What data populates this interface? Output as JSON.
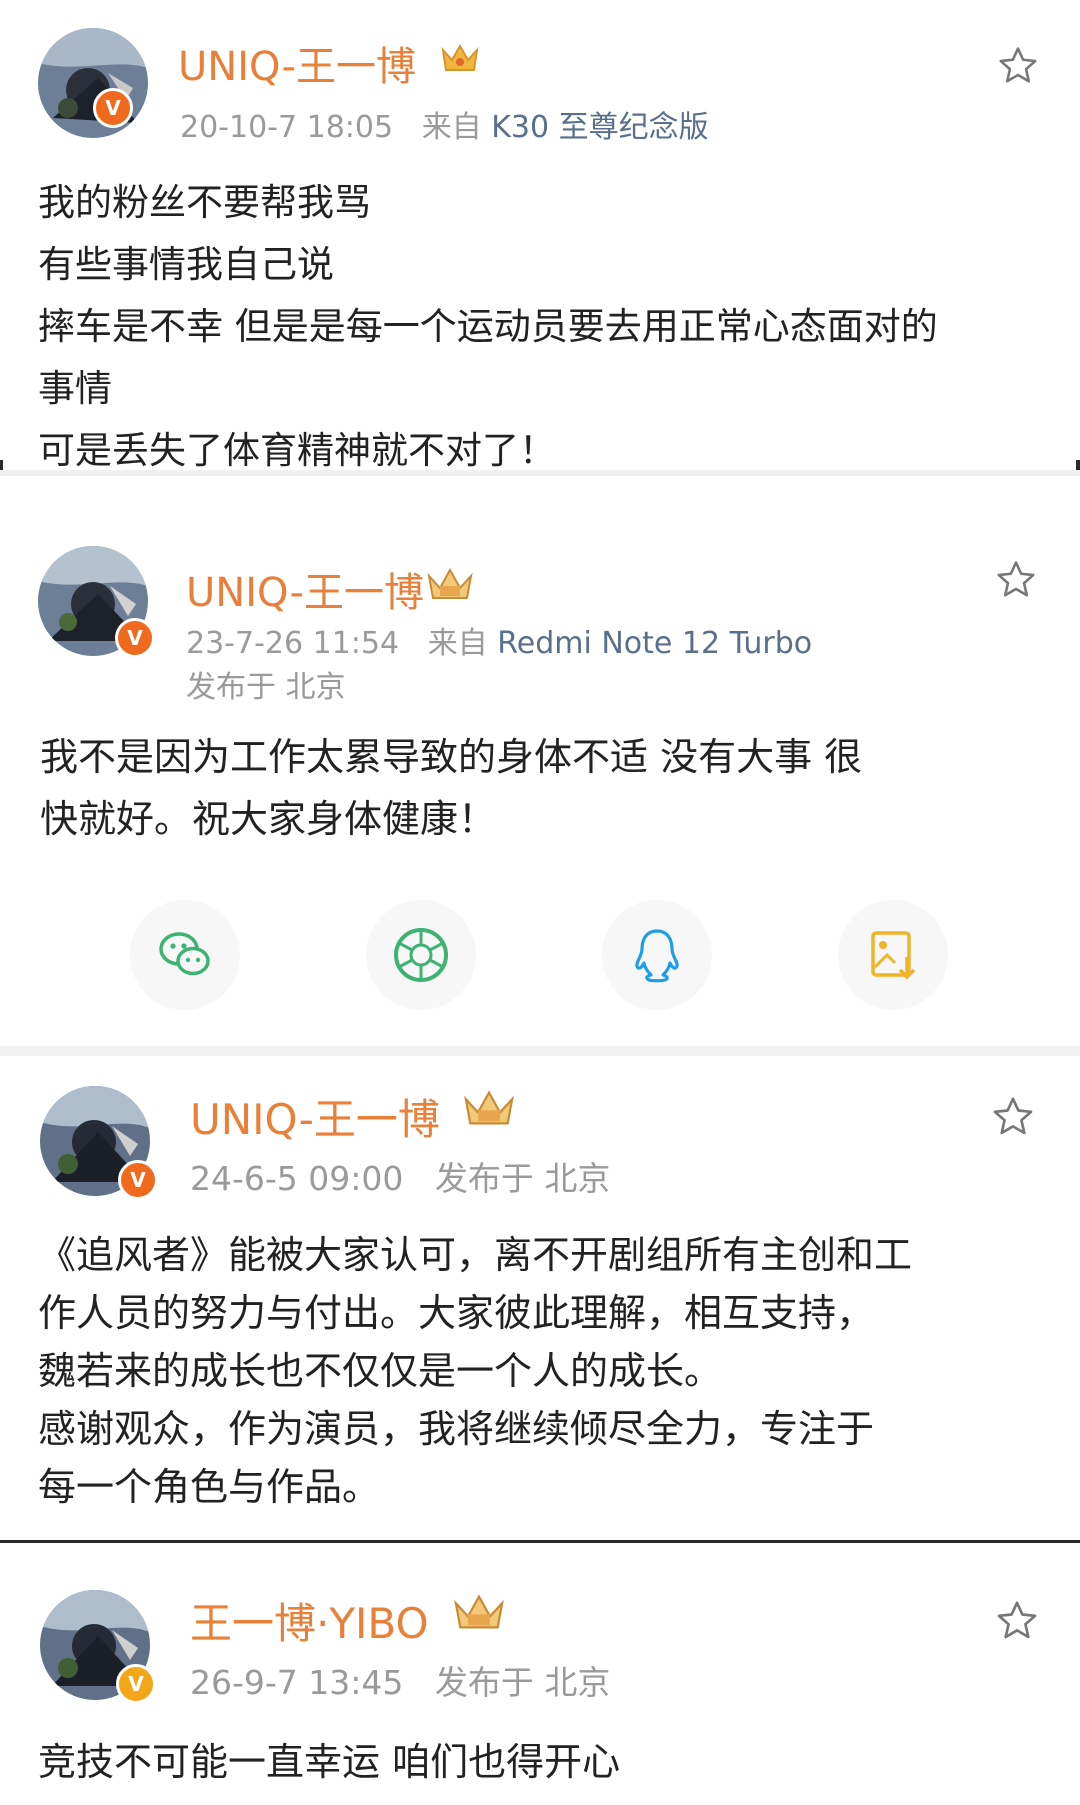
{
  "posts": [
    {
      "username": "UNIQ-王一博",
      "date": "20-10-7 18:05",
      "source_prefix": "来自",
      "source": "K30 至尊纪念版",
      "location": "",
      "text_lines": [
        "我的粉丝不要帮我骂",
        "有些事情我自己说",
        "摔车是不幸 但是是每一个运动员要去用正常心态面对的",
        "事情",
        "可是丢失了体育精神就不对了！"
      ]
    },
    {
      "username": "UNIQ-王一博",
      "date": "23-7-26 11:54",
      "source_prefix": "来自",
      "source": "Redmi Note 12 Turbo",
      "location": "发布于 北京",
      "text_lines": [
        "我不是因为工作太累导致的身体不适 没有大事 很",
        "快就好。祝大家身体健康！"
      ]
    },
    {
      "username": "UNIQ-王一博",
      "date": "24-6-5 09:00",
      "location": "发布于 北京",
      "text_lines": [
        "《追风者》能被大家认可，离不开剧组所有主创和工",
        "作人员的努力与付出。大家彼此理解，相互支持，",
        "魏若来的成长也不仅仅是一个人的成长。",
        "感谢观众，作为演员，我将继续倾尽全力，专注于",
        "每一个角色与作品。"
      ]
    },
    {
      "username": "王一博·YIBO",
      "date": "26-9-7 13:45",
      "location": "发布于 北京",
      "text_lines": [
        "竞技不可能一直幸运 咱们也得开心"
      ]
    }
  ],
  "share_row": {
    "icons": [
      "wechat-icon",
      "moments-icon",
      "qq-icon",
      "save-image-icon"
    ]
  },
  "badges": {
    "verified": "V"
  },
  "colors": {
    "username": "#e8803a",
    "meta": "#9a9a9a",
    "wechat": "#3cb371",
    "moments": "#3cb371",
    "qq": "#1e9ee8",
    "save": "#f0b429",
    "badge": "#f06a1d"
  }
}
